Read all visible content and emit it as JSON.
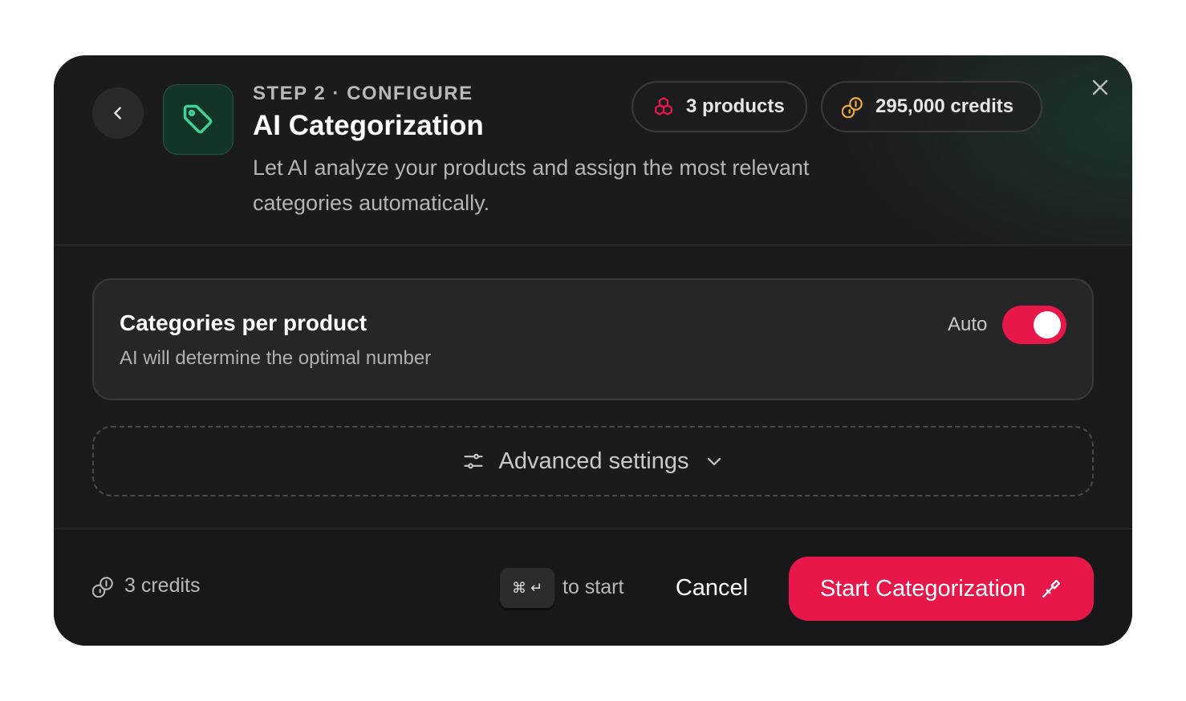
{
  "header": {
    "step_label": "STEP 2 · CONFIGURE",
    "title": "AI Categorization",
    "description": "Let AI analyze your products and assign the most relevant categories automatically.",
    "products_badge": "3 products",
    "credits_badge": "295,000 credits"
  },
  "settings": {
    "categories_title": "Categories per product",
    "categories_subtitle": "AI will determine the optimal number",
    "auto_label": "Auto",
    "auto_enabled": true,
    "advanced_label": "Advanced settings"
  },
  "footer": {
    "cost_label": "3 credits",
    "shortcut_keys": "⌘ ↵",
    "shortcut_hint": "to start",
    "cancel_label": "Cancel",
    "start_label": "Start Categorization"
  },
  "colors": {
    "accent": "#e8174a",
    "background": "#1b1b1c",
    "tag_green": "#3fd39a",
    "credits_gold": "#f0a93b"
  },
  "icons": {
    "back": "chevron-left-icon",
    "tag": "tag-icon",
    "products": "boxes-icon",
    "credits": "coins-icon",
    "close": "close-icon",
    "settings": "sliders-icon",
    "expand": "chevron-down-icon",
    "start": "wand-icon"
  }
}
